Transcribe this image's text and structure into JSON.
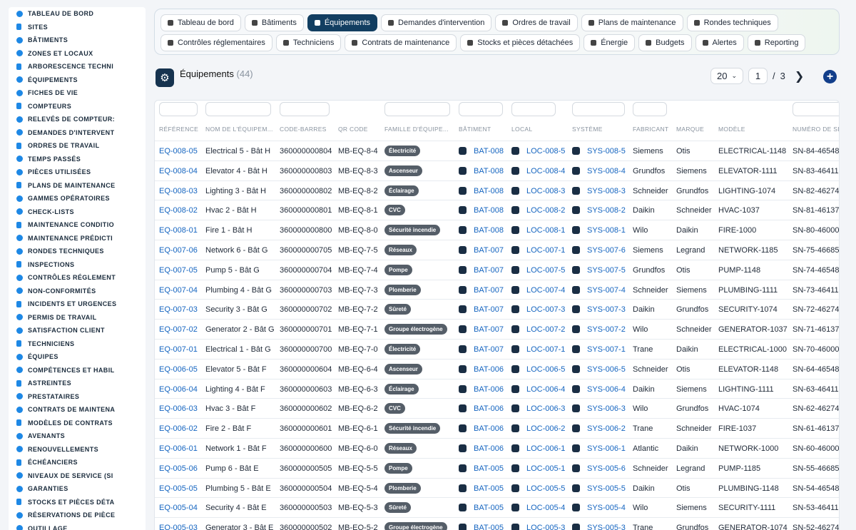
{
  "sidebar": {
    "items": [
      {
        "label": "TABLEAU DE BORD",
        "icon": "dashboard-icon"
      },
      {
        "label": "SITES",
        "icon": "location-pin-icon"
      },
      {
        "label": "BÂTIMENTS",
        "icon": "building-icon"
      },
      {
        "label": "ZONES ET LOCAUX",
        "icon": "map-icon"
      },
      {
        "label": "ARBORESCENCE TECHNI",
        "icon": "tree-icon"
      },
      {
        "label": "ÉQUIPEMENTS",
        "icon": "cogs-icon"
      },
      {
        "label": "FICHES DE VIE",
        "icon": "history-icon"
      },
      {
        "label": "COMPTEURS",
        "icon": "gauge-icon"
      },
      {
        "label": "RELEVÉS DE COMPTEUR:",
        "icon": "clipboard-icon"
      },
      {
        "label": "DEMANDES D'INTERVENT",
        "icon": "question-icon"
      },
      {
        "label": "ORDRES DE TRAVAIL",
        "icon": "clipboard-icon"
      },
      {
        "label": "TEMPS PASSÉS",
        "icon": "clock-icon"
      },
      {
        "label": "PIÈCES UTILISÉES",
        "icon": "boxes-icon"
      },
      {
        "label": "PLANS DE MAINTENANCE",
        "icon": "calendar-icon"
      },
      {
        "label": "GAMMES OPÉRATOIRES",
        "icon": "list-icon"
      },
      {
        "label": "CHECK-LISTS",
        "icon": "checklist-icon"
      },
      {
        "label": "MAINTENANCE CONDITIO",
        "icon": "thermometer-icon"
      },
      {
        "label": "MAINTENANCE PRÉDICTI",
        "icon": "chart-icon"
      },
      {
        "label": "RONDES TECHNIQUES",
        "icon": "route-icon"
      },
      {
        "label": "INSPECTIONS",
        "icon": "search-icon"
      },
      {
        "label": "CONTRÔLES RÉGLEMENT",
        "icon": "clipboard-check-icon"
      },
      {
        "label": "NON-CONFORMITÉS",
        "icon": "exclamation-icon"
      },
      {
        "label": "INCIDENTS ET URGENCES",
        "icon": "warning-icon"
      },
      {
        "label": "PERMIS DE TRAVAIL",
        "icon": "file-icon"
      },
      {
        "label": "SATISFACTION CLIENT",
        "icon": "smile-icon"
      },
      {
        "label": "TECHNICIENS",
        "icon": "hardhat-icon"
      },
      {
        "label": "ÉQUIPES",
        "icon": "users-icon"
      },
      {
        "label": "COMPÉTENCES ET HABIL",
        "icon": "certificate-icon"
      },
      {
        "label": "ASTREINTES",
        "icon": "phone-icon"
      },
      {
        "label": "PRESTATAIRES",
        "icon": "handshake-icon"
      },
      {
        "label": "CONTRATS DE MAINTENA",
        "icon": "file-contract-icon"
      },
      {
        "label": "MODÈLES DE CONTRATS",
        "icon": "file-icon"
      },
      {
        "label": "AVENANTS",
        "icon": "file-plus-icon"
      },
      {
        "label": "RENOUVELLEMENTS",
        "icon": "refresh-icon"
      },
      {
        "label": "ÉCHÉANCIERS",
        "icon": "calendar-icon"
      },
      {
        "label": "NIVEAUX DE SERVICE (SI",
        "icon": "gauge-icon"
      },
      {
        "label": "GARANTIES",
        "icon": "shield-icon"
      },
      {
        "label": "STOCKS ET PIÈCES DÉTA",
        "icon": "boxes-icon"
      },
      {
        "label": "RÉSERVATIONS DE PIÈCE",
        "icon": "bookmark-icon"
      },
      {
        "label": "OUTILLAGE",
        "icon": "tools-icon"
      }
    ]
  },
  "nav": {
    "row1": [
      {
        "label": "Tableau de bord",
        "icon": "dashboard-icon",
        "active": false
      },
      {
        "label": "Bâtiments",
        "icon": "building-icon",
        "active": false
      },
      {
        "label": "Équipements",
        "icon": "cogs-icon",
        "active": true
      },
      {
        "label": "Demandes d'intervention",
        "icon": "question-icon",
        "active": false
      },
      {
        "label": "Ordres de travail",
        "icon": "clipboard-icon",
        "active": false
      },
      {
        "label": "Plans de maintenance",
        "icon": "calendar-icon",
        "active": false
      },
      {
        "label": "Rondes techniques",
        "icon": "route-icon",
        "active": false
      }
    ],
    "row2": [
      {
        "label": "Contrôles réglementaires",
        "icon": "clipboard-check-icon",
        "active": false
      },
      {
        "label": "Techniciens",
        "icon": "hardhat-icon",
        "active": false
      },
      {
        "label": "Contrats de maintenance",
        "icon": "file-contract-icon",
        "active": false
      },
      {
        "label": "Stocks et pièces détachées",
        "icon": "boxes-icon",
        "active": false
      },
      {
        "label": "Énergie",
        "icon": "bolt-icon",
        "active": false
      },
      {
        "label": "Budgets",
        "icon": "money-icon",
        "active": false
      },
      {
        "label": "Alertes",
        "icon": "bell-icon",
        "active": false
      },
      {
        "label": "Reporting",
        "icon": "chart-pie-icon",
        "active": false
      }
    ]
  },
  "page": {
    "title": "Équipements",
    "count": "(44)"
  },
  "pager": {
    "page_size": "20",
    "current_page": "1",
    "separator": "/",
    "total_pages": "3"
  },
  "table": {
    "headers": [
      "RÉFÉRENCE",
      "NOM DE L'ÉQUIPEM...",
      "CODE-BARRES",
      "QR CODE",
      "FAMILLE D'ÉQUIPE...",
      "BÂTIMENT",
      "LOCAL",
      "SYSTÈME",
      "FABRICANT",
      "MARQUE",
      "MODÈLE",
      "NUMÉRO DE SÉ"
    ],
    "rows": [
      [
        "EQ-008-05",
        "Electrical 5 - Bât H",
        "360000000804",
        "MB-EQ-8-4",
        "Électricité",
        "BAT-008",
        "LOC-008-5",
        "SYS-008-5",
        "Siemens",
        "Otis",
        "ELECTRICAL-1148",
        "SN-84-46548"
      ],
      [
        "EQ-008-04",
        "Elevator 4 - Bât H",
        "360000000803",
        "MB-EQ-8-3",
        "Ascenseur",
        "BAT-008",
        "LOC-008-4",
        "SYS-008-4",
        "Grundfos",
        "Siemens",
        "ELEVATOR-1111",
        "SN-83-46411"
      ],
      [
        "EQ-008-03",
        "Lighting 3 - Bât H",
        "360000000802",
        "MB-EQ-8-2",
        "Éclairage",
        "BAT-008",
        "LOC-008-3",
        "SYS-008-3",
        "Schneider",
        "Grundfos",
        "LIGHTING-1074",
        "SN-82-46274"
      ],
      [
        "EQ-008-02",
        "Hvac 2 - Bât H",
        "360000000801",
        "MB-EQ-8-1",
        "CVC",
        "BAT-008",
        "LOC-008-2",
        "SYS-008-2",
        "Daikin",
        "Schneider",
        "HVAC-1037",
        "SN-81-46137"
      ],
      [
        "EQ-008-01",
        "Fire 1 - Bât H",
        "360000000800",
        "MB-EQ-8-0",
        "Sécurité incendie",
        "BAT-008",
        "LOC-008-1",
        "SYS-008-1",
        "Wilo",
        "Daikin",
        "FIRE-1000",
        "SN-80-46000"
      ],
      [
        "EQ-007-06",
        "Network 6 - Bât G",
        "360000000705",
        "MB-EQ-7-5",
        "Réseaux",
        "BAT-007",
        "LOC-007-1",
        "SYS-007-6",
        "Siemens",
        "Legrand",
        "NETWORK-1185",
        "SN-75-46685"
      ],
      [
        "EQ-007-05",
        "Pump 5 - Bât G",
        "360000000704",
        "MB-EQ-7-4",
        "Pompe",
        "BAT-007",
        "LOC-007-5",
        "SYS-007-5",
        "Grundfos",
        "Otis",
        "PUMP-1148",
        "SN-74-46548"
      ],
      [
        "EQ-007-04",
        "Plumbing 4 - Bât G",
        "360000000703",
        "MB-EQ-7-3",
        "Plomberie",
        "BAT-007",
        "LOC-007-4",
        "SYS-007-4",
        "Schneider",
        "Siemens",
        "PLUMBING-1111",
        "SN-73-46411"
      ],
      [
        "EQ-007-03",
        "Security 3 - Bât G",
        "360000000702",
        "MB-EQ-7-2",
        "Sûreté",
        "BAT-007",
        "LOC-007-3",
        "SYS-007-3",
        "Daikin",
        "Grundfos",
        "SECURITY-1074",
        "SN-72-46274"
      ],
      [
        "EQ-007-02",
        "Generator 2 - Bât G",
        "360000000701",
        "MB-EQ-7-1",
        "Groupe électrogène",
        "BAT-007",
        "LOC-007-2",
        "SYS-007-2",
        "Wilo",
        "Schneider",
        "GENERATOR-1037",
        "SN-71-46137"
      ],
      [
        "EQ-007-01",
        "Electrical 1 - Bât G",
        "360000000700",
        "MB-EQ-7-0",
        "Électricité",
        "BAT-007",
        "LOC-007-1",
        "SYS-007-1",
        "Trane",
        "Daikin",
        "ELECTRICAL-1000",
        "SN-70-46000"
      ],
      [
        "EQ-006-05",
        "Elevator 5 - Bât F",
        "360000000604",
        "MB-EQ-6-4",
        "Ascenseur",
        "BAT-006",
        "LOC-006-5",
        "SYS-006-5",
        "Schneider",
        "Otis",
        "ELEVATOR-1148",
        "SN-64-46548"
      ],
      [
        "EQ-006-04",
        "Lighting 4 - Bât F",
        "360000000603",
        "MB-EQ-6-3",
        "Éclairage",
        "BAT-006",
        "LOC-006-4",
        "SYS-006-4",
        "Daikin",
        "Siemens",
        "LIGHTING-1111",
        "SN-63-46411"
      ],
      [
        "EQ-006-03",
        "Hvac 3 - Bât F",
        "360000000602",
        "MB-EQ-6-2",
        "CVC",
        "BAT-006",
        "LOC-006-3",
        "SYS-006-3",
        "Wilo",
        "Grundfos",
        "HVAC-1074",
        "SN-62-46274"
      ],
      [
        "EQ-006-02",
        "Fire 2 - Bât F",
        "360000000601",
        "MB-EQ-6-1",
        "Sécurité incendie",
        "BAT-006",
        "LOC-006-2",
        "SYS-006-2",
        "Trane",
        "Schneider",
        "FIRE-1037",
        "SN-61-46137"
      ],
      [
        "EQ-006-01",
        "Network 1 - Bât F",
        "360000000600",
        "MB-EQ-6-0",
        "Réseaux",
        "BAT-006",
        "LOC-006-1",
        "SYS-006-1",
        "Atlantic",
        "Daikin",
        "NETWORK-1000",
        "SN-60-46000"
      ],
      [
        "EQ-005-06",
        "Pump 6 - Bât E",
        "360000000505",
        "MB-EQ-5-5",
        "Pompe",
        "BAT-005",
        "LOC-005-1",
        "SYS-005-6",
        "Schneider",
        "Legrand",
        "PUMP-1185",
        "SN-55-46685"
      ],
      [
        "EQ-005-05",
        "Plumbing 5 - Bât E",
        "360000000504",
        "MB-EQ-5-4",
        "Plomberie",
        "BAT-005",
        "LOC-005-5",
        "SYS-005-5",
        "Daikin",
        "Otis",
        "PLUMBING-1148",
        "SN-54-46548"
      ],
      [
        "EQ-005-04",
        "Security 4 - Bât E",
        "360000000503",
        "MB-EQ-5-3",
        "Sûreté",
        "BAT-005",
        "LOC-005-4",
        "SYS-005-4",
        "Wilo",
        "Siemens",
        "SECURITY-1111",
        "SN-53-46411"
      ],
      [
        "EQ-005-03",
        "Generator 3 - Bât E",
        "360000000502",
        "MB-EQ-5-2",
        "Groupe électrogène",
        "BAT-005",
        "LOC-005-3",
        "SYS-005-3",
        "Trane",
        "Grundfos",
        "GENERATOR-1074",
        "SN-52-46274"
      ]
    ]
  }
}
